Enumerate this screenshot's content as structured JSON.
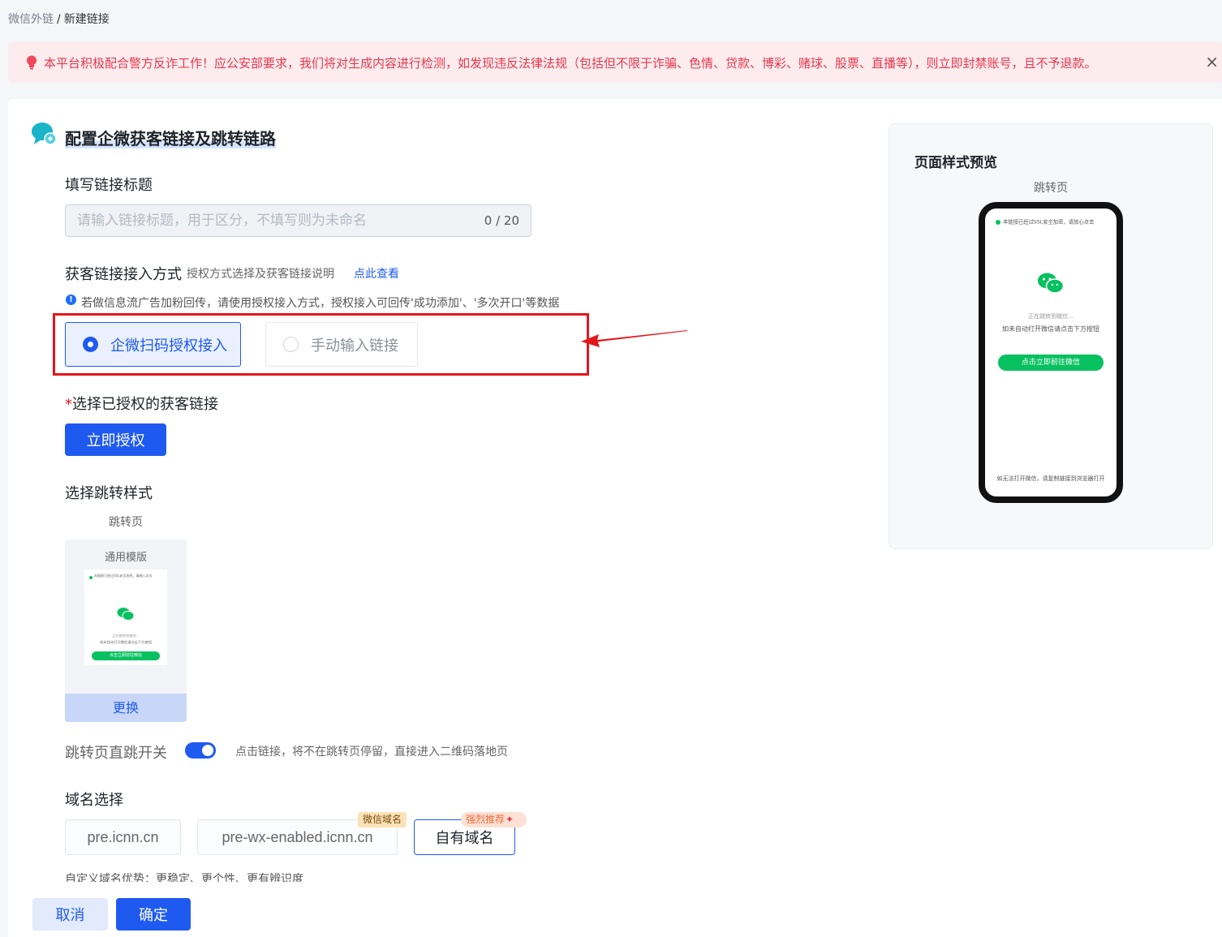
{
  "breadcrumb": {
    "parent": "微信外链",
    "separator": "/",
    "current": "新建链接"
  },
  "alert": {
    "text": "本平台积极配合警方反诈工作！应公安部要求，我们将对生成内容进行检测，如发现违反法律法规（包括但不限于诈骗、色情、贷款、博彩、赌球、股票、直播等），则立即封禁账号，且不予退款。",
    "close": "×",
    "color": "#e8384d"
  },
  "section": {
    "title": "配置企微获客链接及跳转链路"
  },
  "link_title": {
    "label": "填写链接标题",
    "placeholder": "请输入链接标题，用于区分，不填写则为未命名",
    "value": "",
    "counter": "0 / 20"
  },
  "access_mode": {
    "label": "获客链接接入方式",
    "desc": "授权方式选择及获客链接说明",
    "link": "点此查看",
    "tip_icon": "!",
    "tip": "若做信息流广告加粉回传，请使用授权接入方式，授权接入可回传'成功添加'、'多次开口'等数据",
    "options": [
      {
        "label": "企微扫码授权接入",
        "selected": true
      },
      {
        "label": "手动输入链接",
        "selected": false
      }
    ]
  },
  "auth_link": {
    "required_mark": "*",
    "label": "选择已授权的获客链接",
    "button": "立即授权"
  },
  "jump_style": {
    "label": "选择跳转样式",
    "sub": "跳转页",
    "template_name": "通用模版",
    "change": "更换"
  },
  "direct_jump": {
    "label": "跳转页直跳开关",
    "on": true,
    "desc": "点击链接，将不在跳转页停留，直接进入二维码落地页"
  },
  "domain": {
    "label": "域名选择",
    "options": [
      {
        "label": "pre.icnn.cn",
        "selected": false
      },
      {
        "label": "pre-wx-enabled.icnn.cn",
        "selected": false,
        "tag": "微信域名"
      },
      {
        "label": "自有域名",
        "selected": true,
        "tag": "强烈推荐"
      }
    ],
    "advantage": "自定义域名优势：更稳定、更个性、更有辨识度"
  },
  "footer": {
    "cancel": "取消",
    "confirm": "确定"
  },
  "preview": {
    "title": "页面样式预览",
    "sub": "跳转页",
    "phone": {
      "ssl": "本链接已经过SSL安全加密，请放心点击",
      "status": "正在跳转到微信...",
      "hint": "如未自动打开微信请点击下方按钮",
      "button": "点击立即前往微信",
      "footer": "如无法打开微信，请复制链接到浏览器打开"
    }
  },
  "colors": {
    "primary": "#1f5af0",
    "wechat_green": "#07c160",
    "annotation_red": "#e5161b"
  }
}
